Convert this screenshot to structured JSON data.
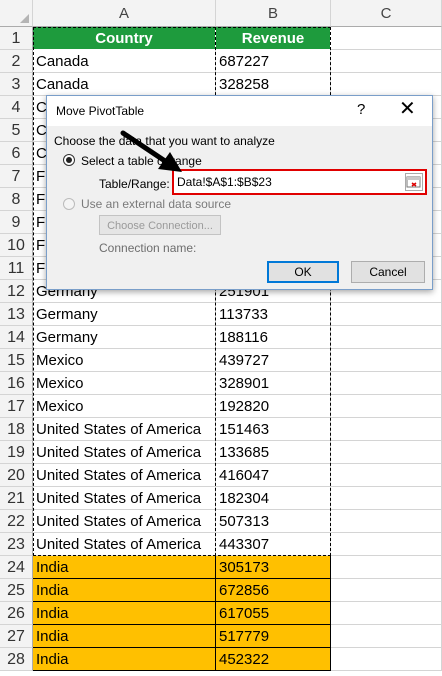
{
  "columns": [
    "A",
    "B",
    "C"
  ],
  "header_row": {
    "row": "1",
    "country": "Country",
    "revenue": "Revenue"
  },
  "rows": [
    {
      "row": "2",
      "country": "Canada",
      "revenue": "687227"
    },
    {
      "row": "3",
      "country": "Canada",
      "revenue": "328258"
    },
    {
      "row": "4",
      "country": "C",
      "revenue": ""
    },
    {
      "row": "5",
      "country": "C",
      "revenue": ""
    },
    {
      "row": "6",
      "country": "C",
      "revenue": ""
    },
    {
      "row": "7",
      "country": "F",
      "revenue": ""
    },
    {
      "row": "8",
      "country": "F",
      "revenue": ""
    },
    {
      "row": "9",
      "country": "F",
      "revenue": ""
    },
    {
      "row": "10",
      "country": "F",
      "revenue": ""
    },
    {
      "row": "11",
      "country": "F",
      "revenue": ""
    },
    {
      "row": "12",
      "country": "Germany",
      "revenue": "251901"
    },
    {
      "row": "13",
      "country": "Germany",
      "revenue": "113733"
    },
    {
      "row": "14",
      "country": "Germany",
      "revenue": "188116"
    },
    {
      "row": "15",
      "country": "Mexico",
      "revenue": "439727"
    },
    {
      "row": "16",
      "country": "Mexico",
      "revenue": "328901"
    },
    {
      "row": "17",
      "country": "Mexico",
      "revenue": "192820"
    },
    {
      "row": "18",
      "country": "United States of America",
      "revenue": "151463"
    },
    {
      "row": "19",
      "country": "United States of America",
      "revenue": "133685"
    },
    {
      "row": "20",
      "country": "United States of America",
      "revenue": "416047"
    },
    {
      "row": "21",
      "country": "United States of America",
      "revenue": "182304"
    },
    {
      "row": "22",
      "country": "United States of America",
      "revenue": "507313"
    },
    {
      "row": "23",
      "country": "United States of America",
      "revenue": "443307"
    },
    {
      "row": "24",
      "country": "India",
      "revenue": "305173",
      "highlight": true
    },
    {
      "row": "25",
      "country": "India",
      "revenue": "672856",
      "highlight": true
    },
    {
      "row": "26",
      "country": "India",
      "revenue": "617055",
      "highlight": true
    },
    {
      "row": "27",
      "country": "India",
      "revenue": "517779",
      "highlight": true
    },
    {
      "row": "28",
      "country": "India",
      "revenue": "452322",
      "highlight": true
    }
  ],
  "dialog": {
    "title": "Move PivotTable",
    "help_label": "?",
    "close_label": "✕",
    "prompt": "Choose the data that you want to analyze",
    "option_range": "Select a table or range",
    "table_range_label": "Table/Range:",
    "table_range_value": "Data!$A$1:$B$23",
    "option_external": "Use an external data source",
    "choose_connection": "Choose Connection...",
    "connection_name_label": "Connection name:",
    "ok_label": "OK",
    "cancel_label": "Cancel"
  },
  "colors": {
    "header_green": "#1e9b3d",
    "highlight_orange": "#ffc000",
    "range_border_red": "#e00000"
  }
}
